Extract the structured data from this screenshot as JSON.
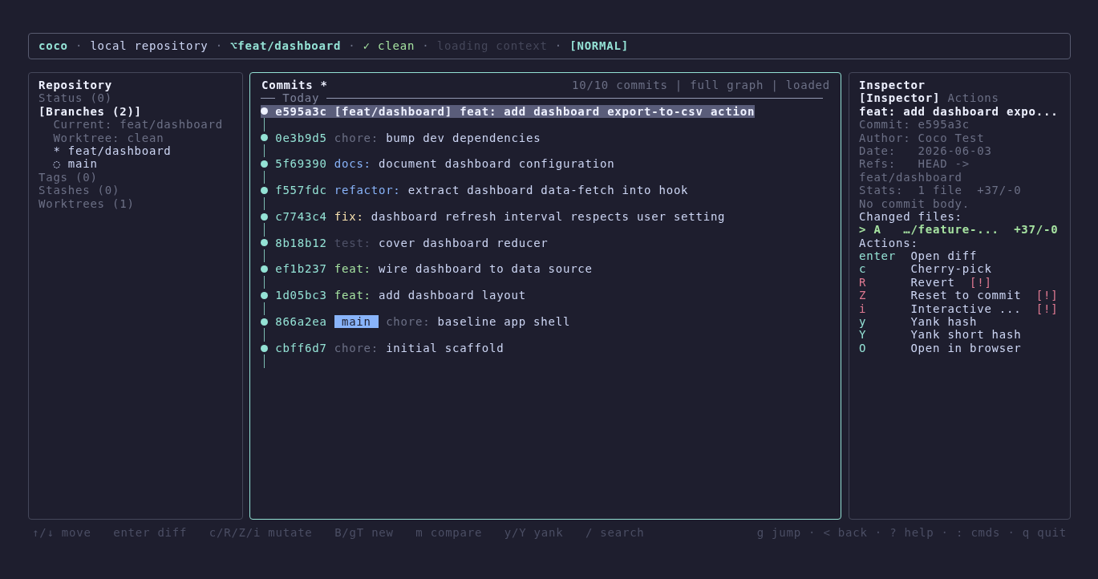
{
  "status_bar": {
    "items": [
      {
        "text": "coco",
        "kind": "app"
      },
      {
        "text": "·",
        "kind": "separator"
      },
      {
        "text": "local repository",
        "kind": "plain"
      },
      {
        "text": "·",
        "kind": "separator"
      },
      {
        "text": "⌥feat/dashboard",
        "kind": "branch"
      },
      {
        "text": "·",
        "kind": "separator"
      },
      {
        "text": "✓ clean",
        "kind": "clean"
      },
      {
        "text": "·",
        "kind": "separator"
      },
      {
        "text": "loading context",
        "kind": "pending"
      },
      {
        "text": "·",
        "kind": "separator"
      },
      {
        "text": "[NORMAL]",
        "kind": "mode"
      }
    ]
  },
  "sidebar": {
    "title": "Repository",
    "focused": false,
    "items": [
      {
        "label": "Status (0)",
        "selected": false
      },
      {
        "label": "[Branches (2)]",
        "selected": true,
        "children": [
          {
            "text": "Current: feat/dashboard",
            "kind": "info"
          },
          {
            "text": "Worktree: clean",
            "kind": "info"
          },
          {
            "text": "* feat/dashboard",
            "kind": "branch"
          },
          {
            "text": "◌ main",
            "kind": "branch"
          }
        ]
      },
      {
        "label": "Tags (0)",
        "selected": false
      },
      {
        "label": "Stashes (0)",
        "selected": false
      },
      {
        "label": "Worktrees (1)",
        "selected": false
      }
    ]
  },
  "commits": {
    "title": "Commits *",
    "summary": "10/10 commits | full graph | loaded",
    "focused": true,
    "group": "Today",
    "rows": [
      {
        "hash": "e595a3c",
        "refs": [
          {
            "label": "[feat/dashboard]",
            "kind": "head"
          }
        ],
        "type": {
          "text": "feat:"
        },
        "subject": "add dashboard export-to-csv action",
        "selected": true
      },
      {
        "hash": "0e3b9d5",
        "type": {
          "text": "chore:",
          "color": "#6c7086"
        },
        "subject": "bump dev dependencies",
        "selected": false
      },
      {
        "hash": "5f69390",
        "type": {
          "text": "docs:",
          "color": "#89b4fa"
        },
        "subject": "document dashboard configuration",
        "selected": false
      },
      {
        "hash": "f557fdc",
        "type": {
          "text": "refactor:",
          "color": "#89b4fa"
        },
        "subject": "extract dashboard data-fetch into hook",
        "selected": false
      },
      {
        "hash": "c7743c4",
        "type": {
          "text": "fix:",
          "color": "#f9e2af"
        },
        "subject": "dashboard refresh interval respects user setting",
        "selected": false
      },
      {
        "hash": "8b18b12",
        "type": {
          "text": "test:",
          "color": "#4f5268"
        },
        "subject": "cover dashboard reducer",
        "selected": false
      },
      {
        "hash": "ef1b237",
        "type": {
          "text": "feat:",
          "color": "#a6e3a1"
        },
        "subject": "wire dashboard to data source",
        "selected": false
      },
      {
        "hash": "1d05bc3",
        "type": {
          "text": "feat:",
          "color": "#a6e3a1"
        },
        "subject": "add dashboard layout",
        "selected": false
      },
      {
        "hash": "866a2ea",
        "refs": [
          {
            "label": "main",
            "kind": "branch"
          }
        ],
        "type": {
          "text": "chore:",
          "color": "#6c7086"
        },
        "subject": "baseline app shell",
        "selected": false
      },
      {
        "hash": "cbff6d7",
        "type": {
          "text": "chore:",
          "color": "#6c7086"
        },
        "subject": "initial scaffold",
        "selected": false
      }
    ]
  },
  "inspector": {
    "title": "Inspector",
    "focused": false,
    "tabs": [
      {
        "label": "[Inspector]",
        "selected": true
      },
      {
        "label": "Actions",
        "selected": false
      }
    ],
    "subject": "feat: add dashboard expo...",
    "details": [
      "Commit: e595a3c",
      "Author: Coco Test",
      "Date:   2026-06-03",
      "Refs:   HEAD ->",
      "feat/dashboard",
      "Stats:  1 file  +37/-0",
      "No commit body."
    ],
    "files_heading": "Changed files:",
    "files": [
      {
        "text": "> A   …/feature-...  +37/-0",
        "selected": true
      }
    ],
    "actions_heading": "Actions:",
    "actions": [
      {
        "key": "enter",
        "label": "Open diff",
        "danger": false
      },
      {
        "key": "c",
        "label": "Cherry-pick",
        "danger": false
      },
      {
        "key": "R",
        "label": "Revert",
        "danger": true,
        "warning": "[!]"
      },
      {
        "key": "Z",
        "label": "Reset to commit",
        "danger": true,
        "warning": "[!]"
      },
      {
        "key": "i",
        "label": "Interactive ...",
        "danger": true,
        "warning": "[!]"
      },
      {
        "key": "y",
        "label": "Yank hash",
        "danger": false
      },
      {
        "key": "Y",
        "label": "Yank short hash",
        "danger": false
      },
      {
        "key": "O",
        "label": "Open in browser",
        "danger": false
      }
    ]
  },
  "footer": {
    "hints": [
      "↑/↓ move",
      "enter diff",
      "c/R/Z/i mutate",
      "B/gT new",
      "m compare",
      "y/Y yank",
      "/ search"
    ],
    "right": "g jump · < back · ? help · : cmds · q quit"
  }
}
